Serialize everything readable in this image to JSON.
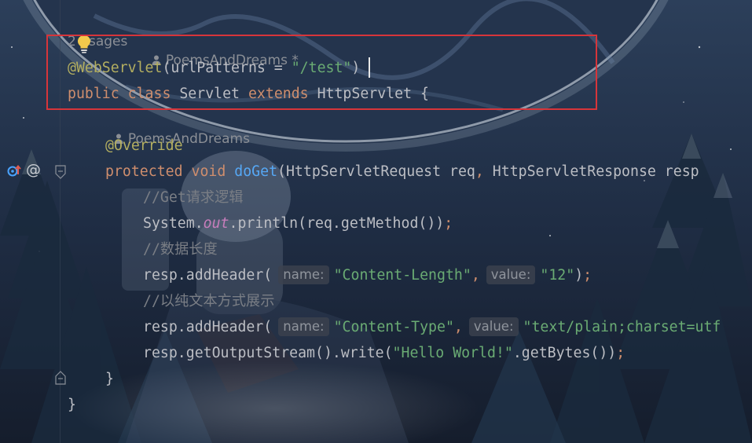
{
  "usages_hint": "2 usages",
  "class_author": "PoemsAndDreams *",
  "method_author": "PoemsAndDreams",
  "code": {
    "annotation_line": {
      "annotation": "@WebServlet",
      "param": "urlPatterns",
      "op": " = ",
      "value": "\"/test\"",
      "close": ")"
    },
    "class_line": {
      "kw1": "public",
      "kw2": "class",
      "name": "Servlet",
      "kw3": "extends",
      "parent": "HttpServlet",
      "brace": "{"
    },
    "override": "@Override",
    "method_line": {
      "kw1": "protected",
      "kw2": "void",
      "name": "doGet",
      "params": "(HttpServletRequest req",
      "comma": ",",
      "params2": " HttpServletResponse resp"
    },
    "comment1": "//Get请求逻辑",
    "println_line": {
      "obj": "System.",
      "field": "out",
      "call": ".println(req.getMethod())",
      "semi": ";"
    },
    "comment2": "//数据长度",
    "header1": {
      "call": "resp.addHeader(",
      "hint_name": "name:",
      "name_value": "\"Content-Length\"",
      "comma": ",",
      "hint_value": "value:",
      "value": "\"12\"",
      "close": ")",
      "semi": ";"
    },
    "comment3": "//以纯文本方式展示",
    "header2": {
      "call": "resp.addHeader(",
      "hint_name": "name:",
      "name_value": "\"Content-Type\"",
      "comma": ",",
      "hint_value": "value:",
      "value": "\"text/plain;charset=utf"
    },
    "write_line": {
      "call": "resp.getOutputStream().write(",
      "str": "\"Hello World!\"",
      "rest": ".getBytes())",
      "semi": ";"
    },
    "method_close": "}",
    "class_close": "}"
  },
  "colors": {
    "keyword": "#cf8e6d",
    "annotation": "#b3ae60",
    "string": "#6aab73",
    "function": "#56a8f5",
    "field": "#c77dbb",
    "comment": "#7a7e85",
    "highlight_border": "#d7353a"
  },
  "icons": [
    "lightbulb-icon",
    "person-icon",
    "implementing-method-icon",
    "annotation-at-icon",
    "fold-icon"
  ]
}
